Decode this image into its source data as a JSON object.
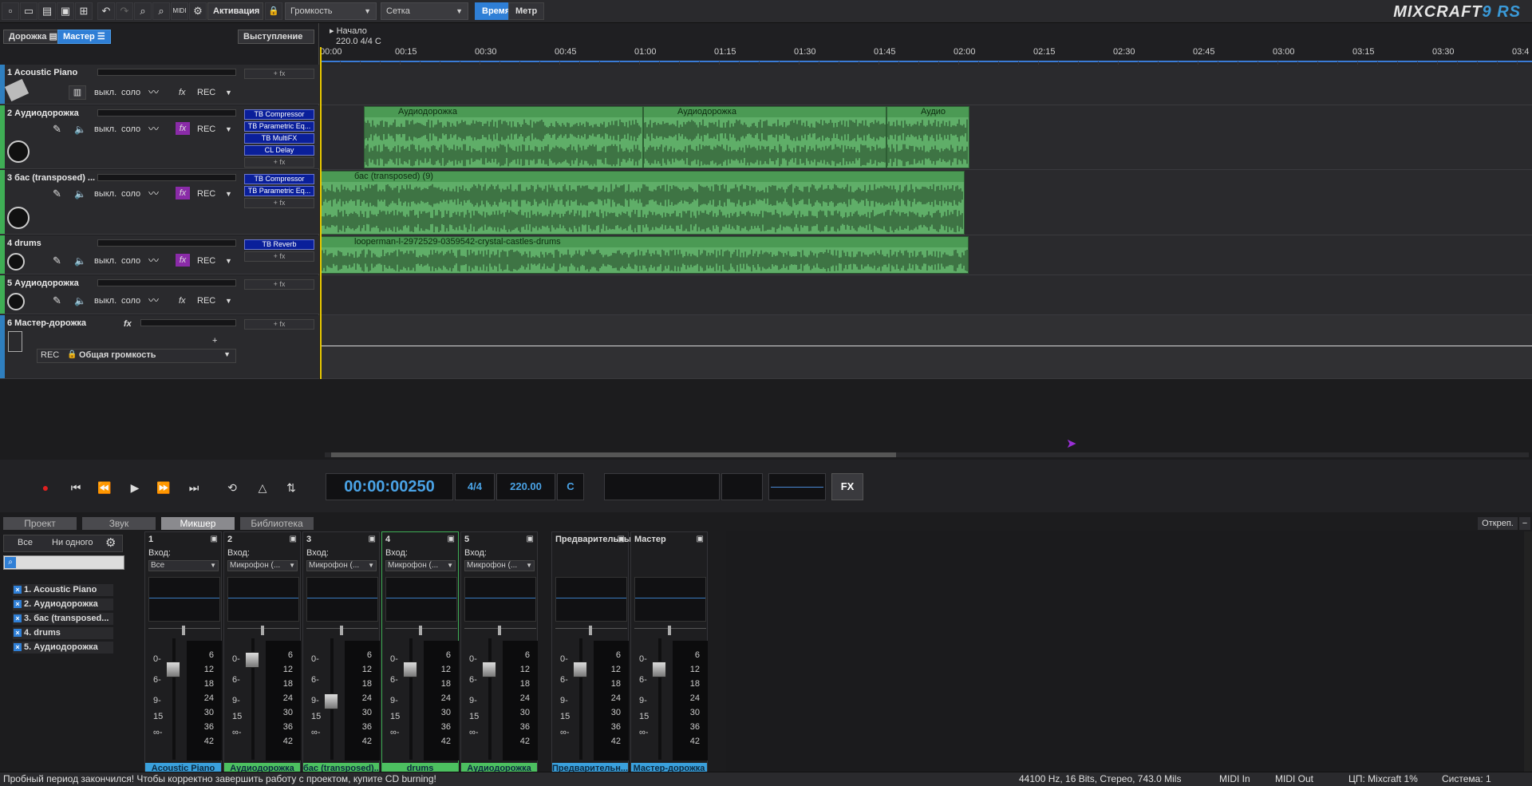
{
  "toolbar": {
    "activation": "Активация",
    "volume_dropdown": "Громкость",
    "grid_dropdown": "Сетка",
    "time_button": "Время",
    "meter_button": "Метр",
    "logo_main": "MIXCRAFT",
    "logo_version": "9 RS"
  },
  "trackpanel": {
    "tab_tracks": "Дорожка",
    "tab_master": "Мастер",
    "performance": "Выступление",
    "off_label": "выкл.",
    "solo_label": "соло",
    "fx_label": "fx",
    "rec_label": "REC",
    "add_fx": "+ fx",
    "tracks": [
      {
        "name": "1 Acoustic Piano",
        "fx": []
      },
      {
        "name": "2 Аудиодорожка",
        "fx": [
          "TB Compressor",
          "TB Parametric Eq...",
          "TB MultiFX",
          "CL Delay"
        ]
      },
      {
        "name": "3 бас (transposed) ...",
        "fx": [
          "TB Compressor",
          "TB Parametric Eq..."
        ]
      },
      {
        "name": "4 drums",
        "fx": [
          "TB Reverb"
        ]
      },
      {
        "name": "5 Аудиодорожка",
        "fx": []
      },
      {
        "name": "6 Мастер-дорожка",
        "fx": []
      }
    ],
    "master_volume": "Общая громкость"
  },
  "ruler": {
    "start_label": "Начало",
    "tempo_info": "220.0 4/4 C",
    "ticks": [
      "00:00",
      "00:15",
      "00:30",
      "00:45",
      "01:00",
      "01:15",
      "01:30",
      "01:45",
      "02:00",
      "02:15",
      "02:30",
      "02:45",
      "03:00",
      "03:15",
      "03:30",
      "03:4"
    ]
  },
  "clips": {
    "audio1": "Аудиодорожка",
    "audio2": "Аудиодорожка",
    "audio3": "Аудио",
    "bass": "бас (transposed) (9)",
    "drums": "looperman-l-2972529-0359542-crystal-castles-drums"
  },
  "transport": {
    "time": "00:00:00250",
    "signature": "4/4",
    "tempo": "220.00",
    "key": "C",
    "fx": "FX"
  },
  "bottom_tabs": [
    "Проект",
    "Звук",
    "Микшер",
    "Библиотека"
  ],
  "undock": "Откреп.",
  "mixer_filter": {
    "all": "Все",
    "none": "Ни одного",
    "items": [
      "1. Acoustic Piano",
      "2. Аудиодорожка",
      "3. бас (transposed...",
      "4. drums",
      "5. Аудиодорожка"
    ]
  },
  "mixer": {
    "input_label": "Вход:",
    "scale_left": [
      "0-",
      "6-",
      "9-",
      "15",
      "∞-"
    ],
    "scale_meter": [
      "6",
      "12",
      "18",
      "24",
      "30",
      "36",
      "42"
    ],
    "channels": [
      {
        "num": "1",
        "input": "Все",
        "foot": "Acoustic Piano",
        "foot_color": "#3aa0dc"
      },
      {
        "num": "2",
        "input": "Микрофон (...",
        "foot": "Аудиодорожка",
        "foot_color": "#4cc060"
      },
      {
        "num": "3",
        "input": "Микрофон (...",
        "foot": "бас (transposed)...",
        "foot_color": "#4cc060"
      },
      {
        "num": "4",
        "input": "Микрофон (...",
        "foot": "drums",
        "foot_color": "#4cc060"
      },
      {
        "num": "5",
        "input": "Микрофон (...",
        "foot": "Аудиодорожка",
        "foot_color": "#4cc060"
      },
      {
        "num": "Предварительный",
        "input": "",
        "foot": "Предварительн...",
        "foot_color": "#3aa0dc"
      },
      {
        "num": "Мастер",
        "input": "",
        "foot": "Мастер-дорожка",
        "foot_color": "#3aa0dc"
      }
    ]
  },
  "status": {
    "message": "Пробный период закончился! Чтобы корректно завершить работу с проектом, купите CD burning!",
    "audio_format": "44100 Hz, 16 Bits, Стерео, 743.0 Mils",
    "midi_in": "MIDI In",
    "midi_out": "MIDI Out",
    "cpu": "ЦП: Mixcraft 1%",
    "system": "Система: 1"
  }
}
